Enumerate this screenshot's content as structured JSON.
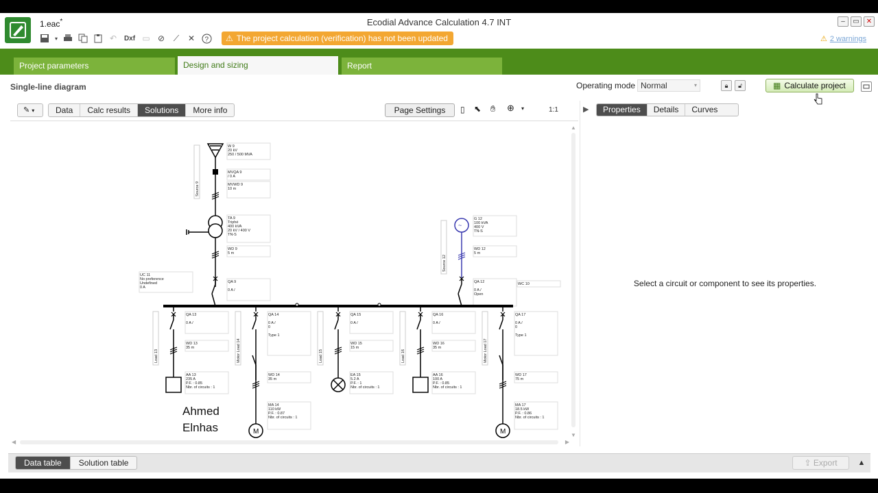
{
  "window": {
    "file_name": "1.eac",
    "modified_mark": "*",
    "title": "Ecodial Advance Calculation 4.7 INT",
    "controls": [
      "–",
      "▭",
      "✕"
    ]
  },
  "toolbar": {
    "dxf_label": "Dxf",
    "banner": "The project calculation (verification) has not been updated",
    "warnings": "2 warnings"
  },
  "main_tabs": [
    "Project parameters",
    "Design and sizing",
    "Report"
  ],
  "diagram_header": {
    "title": "Single-line diagram",
    "operating_mode_label": "Operating mode",
    "operating_mode_value": "Normal",
    "calculate_label": "Calculate project"
  },
  "view_tabs": [
    "Data",
    "Calc results",
    "Solutions",
    "More info"
  ],
  "page_settings": "Page Settings",
  "scale": "1:1",
  "right_tabs": [
    "Properties",
    "Details",
    "Curves"
  ],
  "properties_message": "Select a circuit or component to see its properties.",
  "bottom_tabs": [
    "Data table",
    "Solution table"
  ],
  "export_label": "Export",
  "watermark": [
    "Ahmed",
    "Elnhas"
  ],
  "diagram": {
    "source_main": {
      "label": [
        "W 9",
        "20 kV",
        "250 / 500 MVA"
      ],
      "mv_switch": [
        "MVQA 9",
        "/ 0 A"
      ],
      "mv_cable": [
        "MVWD 9",
        "10 m"
      ],
      "vlabel": "Source 9"
    },
    "transformer": {
      "label": [
        "TA 9",
        "Triphé",
        "400 kVA",
        "20 kV / 400 V",
        "TN-S"
      ],
      "cable": [
        "WD 9",
        "5 m"
      ],
      "breaker": [
        "QA 9",
        "",
        "0 A /"
      ]
    },
    "uc": [
      "UC 11",
      "No preference",
      "Undefined",
      "0 A"
    ],
    "generator": {
      "label": [
        "G 12",
        "100 kVA",
        "400 V",
        "TN-S"
      ],
      "cable": [
        "WD 12",
        "5 m"
      ],
      "breaker": [
        "QA 12",
        "",
        "0 A /",
        "Open"
      ],
      "vlabel": "Source 12"
    },
    "busbar": "WC 10",
    "feeders": [
      {
        "breaker": [
          "QA 13",
          "",
          "0 A /"
        ],
        "cable": [
          "WD 13",
          "35 m"
        ],
        "load": [
          "AA 13",
          "235 A",
          "P.F. : 0.85",
          "Nbr. of circuits : 1"
        ],
        "vlabel": "Load 13"
      },
      {
        "breaker": [
          "QA 14",
          "",
          "0 A /",
          "0",
          "",
          "Type 1"
        ],
        "cable": [
          "WD 14",
          "35 m"
        ],
        "load": [
          "MA 14",
          "110 kW",
          "P.F. : 0.87",
          "Nbr. of circuits : 1"
        ],
        "vlabel": "Motor Load 14"
      },
      {
        "breaker": [
          "QA 15",
          "",
          "0 A /"
        ],
        "cable": [
          "WD 15",
          "15 m"
        ],
        "load": [
          "EA 15",
          "5.2 A",
          "P.F. : 1",
          "Nbr. of circuits : 1"
        ],
        "vlabel": "Load 15"
      },
      {
        "breaker": [
          "QA 16",
          "",
          "0 A /"
        ],
        "cable": [
          "WD 16",
          "35 m"
        ],
        "load": [
          "AA 16",
          "100 A",
          "P.F. : 0.85",
          "Nbr. of circuits : 1"
        ],
        "vlabel": "Load 16"
      },
      {
        "breaker": [
          "QA 17",
          "",
          "0 A /",
          "0",
          "",
          "Type 1"
        ],
        "cable": [
          "WD 17",
          "75 m"
        ],
        "load": [
          "MA 17",
          "18.5 kW",
          "P.F. : 0.86",
          "Nbr. of circuits : 1"
        ],
        "vlabel": "Motor Load 17"
      }
    ]
  },
  "colors": {
    "brand_green": "#4d8c1a",
    "tab_green": "#7cb33b",
    "warning_orange": "#f3a732",
    "generator_blue": "#3a3ab0"
  }
}
